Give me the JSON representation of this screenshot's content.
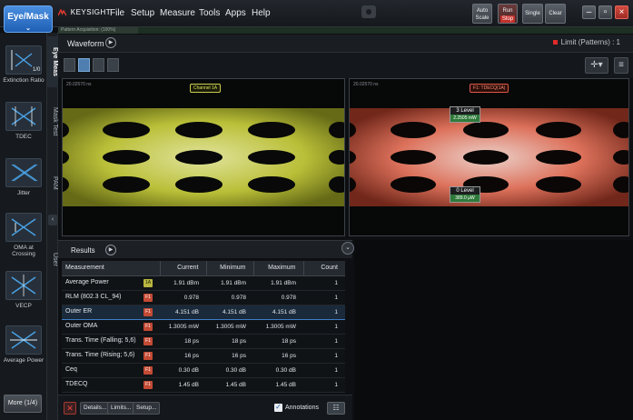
{
  "menubar": {
    "mode_button": "Eye/Mask",
    "brand": "KEYSIGHT",
    "menus": [
      "File",
      "Setup",
      "Measure",
      "Tools",
      "Apps",
      "Help"
    ],
    "auto_scale": "Auto Scale",
    "run_label": "Run",
    "run_state": "Stop",
    "single": "Single",
    "clear": "Clear"
  },
  "status_strip": {
    "acquisition": "Pattern Acquisition: (100%)"
  },
  "sidebar": {
    "items": [
      {
        "label": "Extinction Ratio",
        "icon": "extinction-ratio-icon"
      },
      {
        "label": "TDEC",
        "icon": "tdec-icon"
      },
      {
        "label": "Jitter",
        "icon": "jitter-icon"
      },
      {
        "label": "OMA at Crossing",
        "icon": "oma-crossing-icon"
      },
      {
        "label": "VECP",
        "icon": "vecp-icon"
      },
      {
        "label": "Average Power",
        "icon": "average-power-icon"
      }
    ],
    "more": "More (1/4)"
  },
  "vertical_tabs": [
    "Eye Meas",
    "Mask Test",
    "PAM",
    "User"
  ],
  "waveform": {
    "title": "Waveform",
    "limit": "Limit (Patterns) : 1",
    "left_eye": {
      "timebase": "20.02570 ns",
      "channel": "Channel 1A",
      "color": "#d8e05a"
    },
    "right_eye": {
      "timebase": "20.02570 ns",
      "channel": "F1: TDECQ(1A)",
      "color": "#ff8a70",
      "top_level": {
        "name": "3 Level",
        "value": "2.2505 mW"
      },
      "bottom_level": {
        "name": "0 Level",
        "value": "389.0 µW"
      }
    }
  },
  "results": {
    "title": "Results",
    "columns": [
      "Measurement",
      "Current",
      "Minimum",
      "Maximum",
      "Count"
    ],
    "rows": [
      {
        "name": "Average Power",
        "src": "1A",
        "src_kind": "y",
        "current": "1.91 dBm",
        "minimum": "1.91 dBm",
        "maximum": "1.91 dBm",
        "count": "1"
      },
      {
        "name": "RLM (802.3 CL_94)",
        "src": "F1",
        "src_kind": "r",
        "current": "0.978",
        "minimum": "0.978",
        "maximum": "0.978",
        "count": "1"
      },
      {
        "name": "Outer ER",
        "src": "F1",
        "src_kind": "r",
        "current": "4.151 dB",
        "minimum": "4.151 dB",
        "maximum": "4.151 dB",
        "count": "1"
      },
      {
        "name": "Outer OMA",
        "src": "F1",
        "src_kind": "r",
        "current": "1.3005 mW",
        "minimum": "1.3005 mW",
        "maximum": "1.3005 mW",
        "count": "1"
      },
      {
        "name": "Trans. Time (Falling; 5,6)",
        "src": "F1",
        "src_kind": "r",
        "current": "18 ps",
        "minimum": "18 ps",
        "maximum": "18 ps",
        "count": "1"
      },
      {
        "name": "Trans. Time (Rising; 5,6)",
        "src": "F1",
        "src_kind": "r",
        "current": "16 ps",
        "minimum": "16 ps",
        "maximum": "16 ps",
        "count": "1"
      },
      {
        "name": "Ceq",
        "src": "F1",
        "src_kind": "r",
        "current": "0.30 dB",
        "minimum": "0.30 dB",
        "maximum": "0.30 dB",
        "count": "1"
      },
      {
        "name": "TDECQ",
        "src": "F1",
        "src_kind": "r",
        "current": "1.45 dB",
        "minimum": "1.45 dB",
        "maximum": "1.45 dB",
        "count": "1"
      }
    ],
    "selected_row": 2,
    "footer": {
      "details": "Details...",
      "limits": "Limits...",
      "setup": "Setup...",
      "annotations": "Annotations",
      "annotations_checked": true
    }
  }
}
